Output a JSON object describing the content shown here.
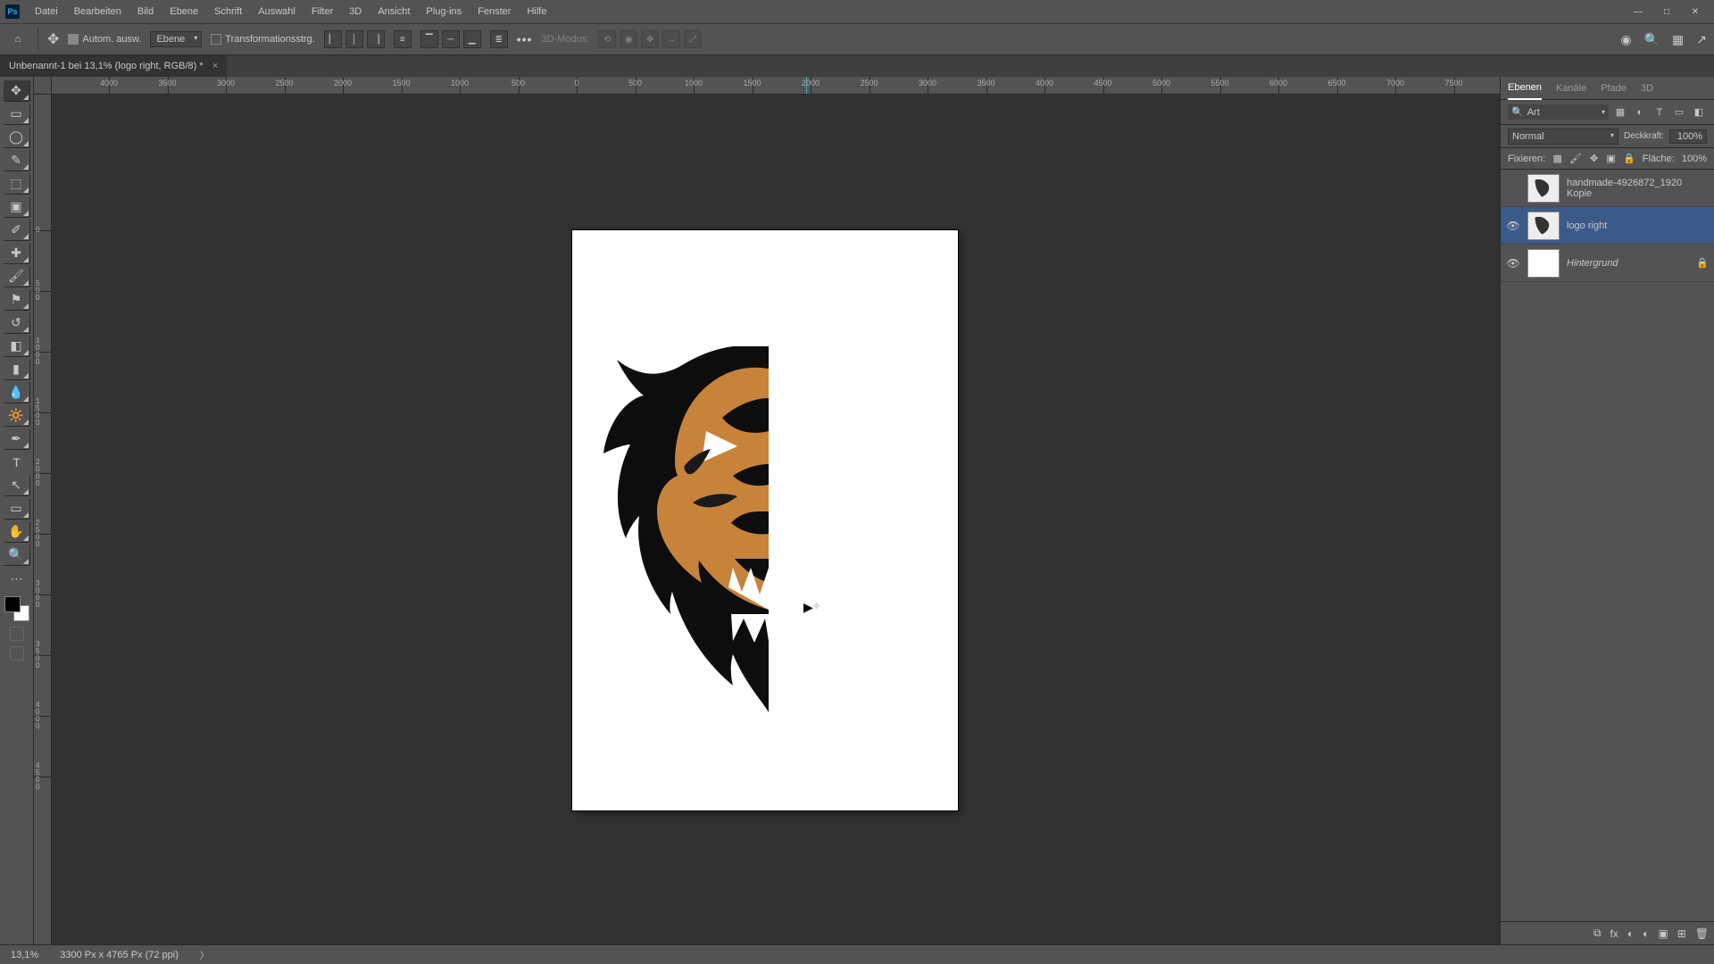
{
  "menu": {
    "items": [
      "Datei",
      "Bearbeiten",
      "Bild",
      "Ebene",
      "Schrift",
      "Auswahl",
      "Filter",
      "3D",
      "Ansicht",
      "Plug-ins",
      "Fenster",
      "Hilfe"
    ]
  },
  "window_buttons": [
    "—",
    "□",
    "✕"
  ],
  "options": {
    "auto_select": "Autom. ausw.",
    "target": "Ebene",
    "transform": "Transformationsstrg.",
    "threeD": "3D-Modus:"
  },
  "doc": {
    "title": "Unbenannt-1 bei 13,1% (logo right, RGB/8) *"
  },
  "ruler": {
    "h": [
      "0",
      "-4000",
      "-3500",
      "-3000",
      "-2500",
      "-2000",
      "-1500",
      "-1000",
      "-500",
      "0",
      "500",
      "1000",
      "1500",
      "2000",
      "2500",
      "3000",
      "3500",
      "4000",
      "4500",
      "5000",
      "5500",
      "6000",
      "6500",
      "7000",
      "7500"
    ],
    "v": [
      "0",
      "500",
      "1000",
      "1500",
      "2000",
      "2500",
      "3000",
      "3500",
      "4000",
      "4500"
    ]
  },
  "layers_panel": {
    "tabs": [
      "Ebenen",
      "Kanäle",
      "Pfade",
      "3D"
    ],
    "filter_kind": "Art",
    "blend_mode": "Normal",
    "opacity_label": "Deckkraft:",
    "opacity_value": "100%",
    "lock_label": "Fixieren:",
    "fill_label": "Fläche:",
    "fill_value": "100%",
    "layers": [
      {
        "visible": false,
        "name": "handmade-4926872_1920 Kopie",
        "selected": false,
        "italic": false,
        "locked": false
      },
      {
        "visible": true,
        "name": "logo right",
        "selected": true,
        "italic": false,
        "locked": false
      },
      {
        "visible": true,
        "name": "Hintergrund",
        "selected": false,
        "italic": true,
        "locked": true
      }
    ]
  },
  "status": {
    "zoom": "13,1%",
    "doc": "3300 Px x 4765 Px (72 ppi)"
  },
  "icons": {
    "home": "⌂",
    "move": "✥",
    "search": "🔍",
    "share": "↗",
    "bell": "⊞",
    "cloud": "☁",
    "align_l": "▏",
    "align_c": "│",
    "align_r": "▕",
    "dist": "≡",
    "valign_t": "▔",
    "valign_m": "─",
    "valign_b": "▁",
    "vdist": "≣",
    "more": "•••",
    "filter_img": "▦",
    "filter_adj": "◐",
    "filter_txt": "T",
    "filter_shape": "▭",
    "filter_smart": "◧",
    "eye": "👁",
    "lock": "🔒",
    "link": "⧉",
    "fx": "fx",
    "mask": "◐",
    "folder": "▣",
    "new": "⊞",
    "trash": "🗑"
  }
}
